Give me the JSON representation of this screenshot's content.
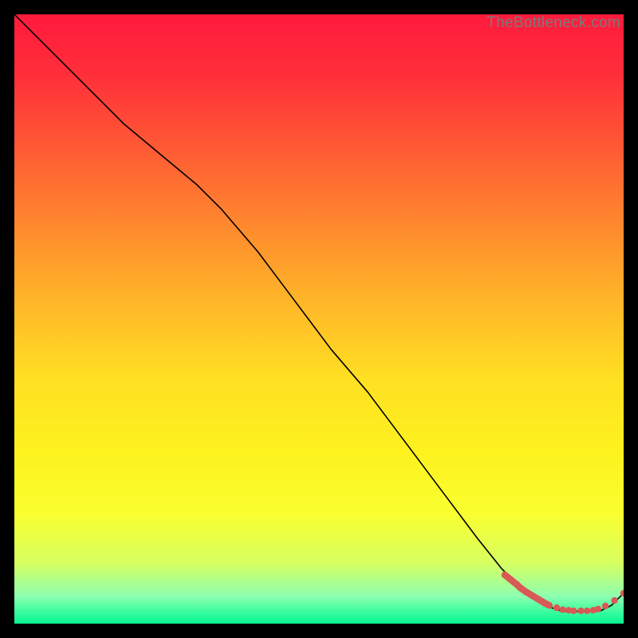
{
  "watermark": "TheBottleneck.com",
  "chart_data": {
    "type": "line",
    "title": "",
    "xlabel": "",
    "ylabel": "",
    "xlim": [
      0,
      100
    ],
    "ylim": [
      0,
      100
    ],
    "grid": false,
    "legend": false,
    "background_gradient": {
      "stops": [
        {
          "offset": 0.0,
          "color": "#ff1a3c"
        },
        {
          "offset": 0.1,
          "color": "#ff2f3a"
        },
        {
          "offset": 0.22,
          "color": "#ff5a34"
        },
        {
          "offset": 0.35,
          "color": "#ff8a2e"
        },
        {
          "offset": 0.48,
          "color": "#ffb928"
        },
        {
          "offset": 0.6,
          "color": "#ffe022"
        },
        {
          "offset": 0.72,
          "color": "#fdf21e"
        },
        {
          "offset": 0.82,
          "color": "#f9ff30"
        },
        {
          "offset": 0.9,
          "color": "#d7ff60"
        },
        {
          "offset": 0.955,
          "color": "#8dffb0"
        },
        {
          "offset": 0.985,
          "color": "#2dfc9c"
        },
        {
          "offset": 1.0,
          "color": "#0af08e"
        }
      ]
    },
    "series": [
      {
        "name": "bottleneck-curve",
        "color": "#000000",
        "stroke_width": 1.6,
        "x": [
          0,
          6,
          12,
          18,
          24,
          30,
          34,
          40,
          46,
          52,
          58,
          64,
          70,
          76,
          80,
          82,
          84,
          87,
          90,
          93,
          96,
          98,
          100
        ],
        "y": [
          100,
          94,
          88,
          82,
          77,
          72,
          68,
          61,
          53,
          45,
          38,
          30,
          22,
          14,
          9,
          7,
          5,
          3,
          2,
          2,
          2,
          3,
          5
        ]
      }
    ],
    "markers": {
      "name": "highlight-segment",
      "color": "#d85a56",
      "radius": 4.2,
      "x": [
        80.5,
        81.5,
        82.5,
        83.0,
        84.0,
        85.0,
        86.0,
        87.0,
        87.8,
        89.0,
        90.0,
        91.0,
        91.8,
        93.0,
        94.0,
        95.0,
        95.8,
        97.0,
        98.5,
        100
      ],
      "y": [
        8.0,
        7.2,
        6.4,
        5.9,
        5.2,
        4.6,
        4.0,
        3.4,
        3.0,
        2.6,
        2.3,
        2.2,
        2.1,
        2.1,
        2.1,
        2.2,
        2.4,
        2.9,
        3.8,
        5.0
      ]
    }
  }
}
